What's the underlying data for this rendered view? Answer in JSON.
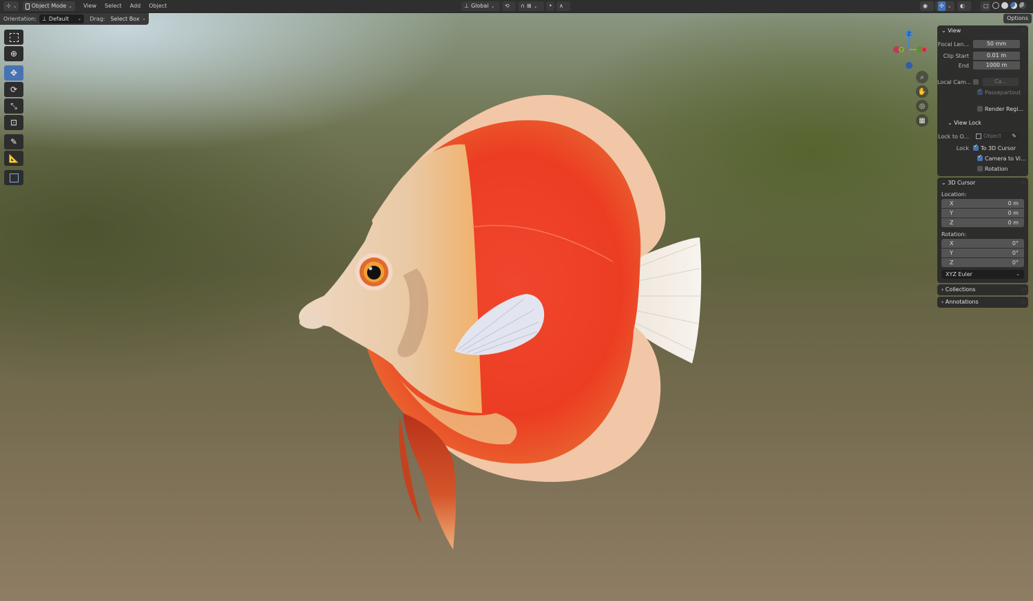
{
  "header": {
    "mode": "Object Mode",
    "menus": [
      "View",
      "Select",
      "Add",
      "Object"
    ],
    "transform": "Global"
  },
  "tool_settings": {
    "orientation_label": "Orientation:",
    "orientation_value": "Default",
    "drag_label": "Drag:",
    "drag_value": "Select Box",
    "options": "Options"
  },
  "tools": [
    "select-box-icon",
    "cursor-icon",
    "move-icon",
    "rotate-icon",
    "scale-icon",
    "transform-icon",
    "annotate-icon",
    "measure-icon",
    "add-cube-icon"
  ],
  "gizmo": {
    "z": "Z",
    "y": "Y",
    "x": "X"
  },
  "panel": {
    "view": {
      "title": "View",
      "focal_label": "Focal Len...",
      "focal_value": "50 mm",
      "clip_start_label": "Clip Start",
      "clip_start_value": "0.01 m",
      "end_label": "End",
      "end_value": "1000 m",
      "local_cam_label": "Local Cam...",
      "local_cam_value": "Ca...",
      "passepartout": "Passepartout",
      "render_region": "Render Regi..."
    },
    "view_lock": {
      "title": "View Lock",
      "lock_to_label": "Lock to O...",
      "lock_to_placeholder": "Object",
      "lock_label": "Lock",
      "to_3d_cursor": "To 3D Cursor",
      "camera_to_view": "Camera to Vi...",
      "rotation": "Rotation"
    },
    "cursor": {
      "title": "3D Cursor",
      "location_label": "Location:",
      "location": [
        {
          "axis": "X",
          "value": "0 m"
        },
        {
          "axis": "Y",
          "value": "0 m"
        },
        {
          "axis": "Z",
          "value": "0 m"
        }
      ],
      "rotation_label": "Rotation:",
      "rotation": [
        {
          "axis": "X",
          "value": "0°"
        },
        {
          "axis": "Y",
          "value": "0°"
        },
        {
          "axis": "Z",
          "value": "0°"
        }
      ],
      "rotation_mode": "XYZ Euler"
    },
    "collections": "Collections",
    "annotations": "Annotations"
  },
  "colors": {
    "accent": "#4772b3",
    "gizmo_x": "#e0445a",
    "gizmo_y": "#7cb342",
    "gizmo_z": "#3b86e3"
  }
}
